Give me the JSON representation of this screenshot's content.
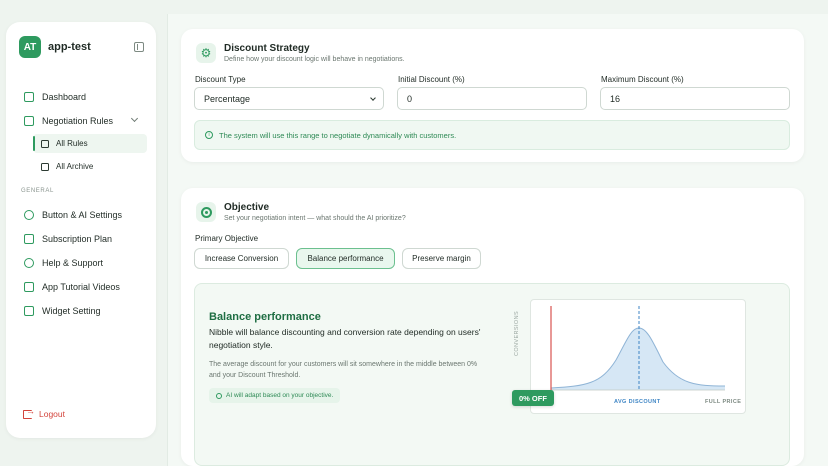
{
  "app": {
    "initials": "AT",
    "name": "app-test"
  },
  "sidebar": {
    "items": [
      {
        "label": "Dashboard"
      },
      {
        "label": "Negotiation Rules"
      }
    ],
    "sub_items": [
      {
        "label": "All Rules"
      },
      {
        "label": "All Archive"
      }
    ],
    "section_label": "GENERAL",
    "general_items": [
      {
        "label": "Button & AI Settings"
      },
      {
        "label": "Subscription Plan"
      },
      {
        "label": "Help & Support"
      },
      {
        "label": "App Tutorial Videos"
      },
      {
        "label": "Widget Setting"
      }
    ],
    "logout_label": "Logout"
  },
  "discount": {
    "title": "Discount Strategy",
    "subtitle": "Define how your discount logic will behave in negotiations.",
    "type_label": "Discount Type",
    "type_value": "Percentage",
    "initial_label": "Initial Discount (%)",
    "initial_value": "0",
    "max_label": "Maximum Discount (%)",
    "max_value": "16",
    "info_text": "The system will use this range to negotiate dynamically with customers."
  },
  "objective": {
    "title": "Objective",
    "subtitle": "Set your negotiation intent — what should the AI prioritize?",
    "primary_label": "Primary Objective",
    "options": [
      {
        "label": "Increase Conversion"
      },
      {
        "label": "Balance performance"
      },
      {
        "label": "Preserve margin"
      }
    ],
    "selected": "Balance performance",
    "detail_title": "Balance performance",
    "detail_desc": "Nibble will balance discounting and conversion rate depending on users' negotiation style.",
    "detail_note": "The average discount for your customers will sit somewhere in the middle between 0% and your Discount Threshold.",
    "detail_badge": "AI will adapt based on your objective."
  },
  "chart": {
    "y_label": "CONVERSIONS",
    "zero_label": "0% OFF",
    "avg_label": "AVG DISCOUNT",
    "full_label": "FULL PRICE"
  },
  "colors": {
    "accent": "#2e9a5f",
    "curve_fill": "#d6e7f5",
    "curve_stroke": "#8fb4d6",
    "zero_line": "#d9534f",
    "avg_line": "#3f86c5",
    "logout": "#d3443c"
  }
}
